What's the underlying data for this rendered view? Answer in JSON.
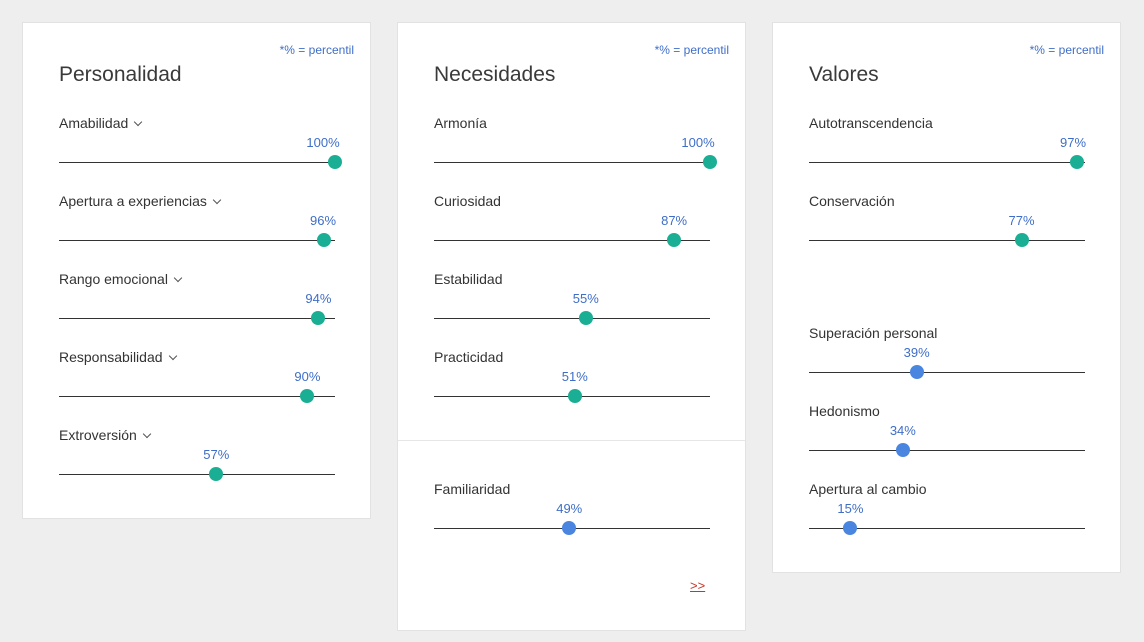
{
  "colors": {
    "high": "#1aaf94",
    "low": "#4a86e0",
    "accent_text": "#3f6ec8",
    "link": "#c0392b"
  },
  "cards": [
    {
      "id": "personalidad",
      "title": "Personalidad",
      "note": "*% = percentil",
      "traits": [
        {
          "label": "Amabilidad",
          "value": 100,
          "display": "100%",
          "expandable": true,
          "level": "high"
        },
        {
          "label": "Apertura a experiencias",
          "value": 96,
          "display": "96%",
          "expandable": true,
          "level": "high"
        },
        {
          "label": "Rango emocional",
          "value": 94,
          "display": "94%",
          "expandable": true,
          "level": "high"
        },
        {
          "label": "Responsabilidad",
          "value": 90,
          "display": "90%",
          "expandable": true,
          "level": "high"
        },
        {
          "label": "Extroversión",
          "value": 57,
          "display": "57%",
          "expandable": true,
          "level": "high"
        }
      ]
    },
    {
      "id": "necesidades",
      "title": "Necesidades",
      "note": "*% = percentil",
      "traits": [
        {
          "label": "Armonía",
          "value": 100,
          "display": "100%",
          "level": "high"
        },
        {
          "label": "Curiosidad",
          "value": 87,
          "display": "87%",
          "level": "high"
        },
        {
          "label": "Estabilidad",
          "value": 55,
          "display": "55%",
          "level": "high"
        },
        {
          "label": "Practicidad",
          "value": 51,
          "display": "51%",
          "level": "high"
        }
      ],
      "lower_traits": [
        {
          "label": "Familiaridad",
          "value": 49,
          "display": "49%",
          "level": "low"
        }
      ],
      "more_link": ">>"
    },
    {
      "id": "valores",
      "title": "Valores",
      "note": "*% = percentil",
      "traits": [
        {
          "label": "Autotranscendencia",
          "value": 97,
          "display": "97%",
          "level": "high"
        },
        {
          "label": "Conservación",
          "value": 77,
          "display": "77%",
          "level": "high"
        }
      ],
      "lower_traits": [
        {
          "label": "Superación personal",
          "value": 39,
          "display": "39%",
          "level": "low"
        },
        {
          "label": "Hedonismo",
          "value": 34,
          "display": "34%",
          "level": "low"
        },
        {
          "label": "Apertura al cambio",
          "value": 15,
          "display": "15%",
          "level": "low"
        }
      ]
    }
  ]
}
